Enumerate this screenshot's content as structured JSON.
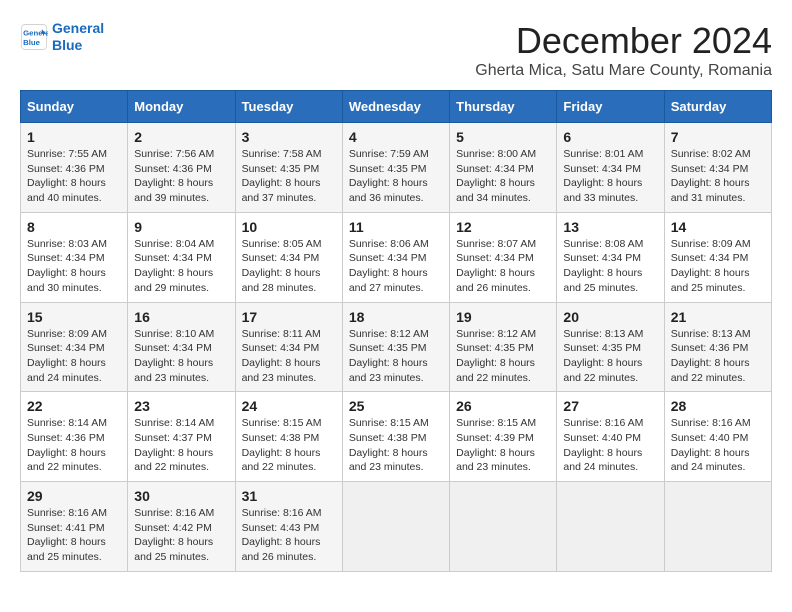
{
  "header": {
    "logo_line1": "General",
    "logo_line2": "Blue",
    "month": "December 2024",
    "location": "Gherta Mica, Satu Mare County, Romania"
  },
  "weekdays": [
    "Sunday",
    "Monday",
    "Tuesday",
    "Wednesday",
    "Thursday",
    "Friday",
    "Saturday"
  ],
  "weeks": [
    [
      {
        "day": "1",
        "info": "Sunrise: 7:55 AM\nSunset: 4:36 PM\nDaylight: 8 hours\nand 40 minutes."
      },
      {
        "day": "2",
        "info": "Sunrise: 7:56 AM\nSunset: 4:36 PM\nDaylight: 8 hours\nand 39 minutes."
      },
      {
        "day": "3",
        "info": "Sunrise: 7:58 AM\nSunset: 4:35 PM\nDaylight: 8 hours\nand 37 minutes."
      },
      {
        "day": "4",
        "info": "Sunrise: 7:59 AM\nSunset: 4:35 PM\nDaylight: 8 hours\nand 36 minutes."
      },
      {
        "day": "5",
        "info": "Sunrise: 8:00 AM\nSunset: 4:34 PM\nDaylight: 8 hours\nand 34 minutes."
      },
      {
        "day": "6",
        "info": "Sunrise: 8:01 AM\nSunset: 4:34 PM\nDaylight: 8 hours\nand 33 minutes."
      },
      {
        "day": "7",
        "info": "Sunrise: 8:02 AM\nSunset: 4:34 PM\nDaylight: 8 hours\nand 31 minutes."
      }
    ],
    [
      {
        "day": "8",
        "info": "Sunrise: 8:03 AM\nSunset: 4:34 PM\nDaylight: 8 hours\nand 30 minutes."
      },
      {
        "day": "9",
        "info": "Sunrise: 8:04 AM\nSunset: 4:34 PM\nDaylight: 8 hours\nand 29 minutes."
      },
      {
        "day": "10",
        "info": "Sunrise: 8:05 AM\nSunset: 4:34 PM\nDaylight: 8 hours\nand 28 minutes."
      },
      {
        "day": "11",
        "info": "Sunrise: 8:06 AM\nSunset: 4:34 PM\nDaylight: 8 hours\nand 27 minutes."
      },
      {
        "day": "12",
        "info": "Sunrise: 8:07 AM\nSunset: 4:34 PM\nDaylight: 8 hours\nand 26 minutes."
      },
      {
        "day": "13",
        "info": "Sunrise: 8:08 AM\nSunset: 4:34 PM\nDaylight: 8 hours\nand 25 minutes."
      },
      {
        "day": "14",
        "info": "Sunrise: 8:09 AM\nSunset: 4:34 PM\nDaylight: 8 hours\nand 25 minutes."
      }
    ],
    [
      {
        "day": "15",
        "info": "Sunrise: 8:09 AM\nSunset: 4:34 PM\nDaylight: 8 hours\nand 24 minutes."
      },
      {
        "day": "16",
        "info": "Sunrise: 8:10 AM\nSunset: 4:34 PM\nDaylight: 8 hours\nand 23 minutes."
      },
      {
        "day": "17",
        "info": "Sunrise: 8:11 AM\nSunset: 4:34 PM\nDaylight: 8 hours\nand 23 minutes."
      },
      {
        "day": "18",
        "info": "Sunrise: 8:12 AM\nSunset: 4:35 PM\nDaylight: 8 hours\nand 23 minutes."
      },
      {
        "day": "19",
        "info": "Sunrise: 8:12 AM\nSunset: 4:35 PM\nDaylight: 8 hours\nand 22 minutes."
      },
      {
        "day": "20",
        "info": "Sunrise: 8:13 AM\nSunset: 4:35 PM\nDaylight: 8 hours\nand 22 minutes."
      },
      {
        "day": "21",
        "info": "Sunrise: 8:13 AM\nSunset: 4:36 PM\nDaylight: 8 hours\nand 22 minutes."
      }
    ],
    [
      {
        "day": "22",
        "info": "Sunrise: 8:14 AM\nSunset: 4:36 PM\nDaylight: 8 hours\nand 22 minutes."
      },
      {
        "day": "23",
        "info": "Sunrise: 8:14 AM\nSunset: 4:37 PM\nDaylight: 8 hours\nand 22 minutes."
      },
      {
        "day": "24",
        "info": "Sunrise: 8:15 AM\nSunset: 4:38 PM\nDaylight: 8 hours\nand 22 minutes."
      },
      {
        "day": "25",
        "info": "Sunrise: 8:15 AM\nSunset: 4:38 PM\nDaylight: 8 hours\nand 23 minutes."
      },
      {
        "day": "26",
        "info": "Sunrise: 8:15 AM\nSunset: 4:39 PM\nDaylight: 8 hours\nand 23 minutes."
      },
      {
        "day": "27",
        "info": "Sunrise: 8:16 AM\nSunset: 4:40 PM\nDaylight: 8 hours\nand 24 minutes."
      },
      {
        "day": "28",
        "info": "Sunrise: 8:16 AM\nSunset: 4:40 PM\nDaylight: 8 hours\nand 24 minutes."
      }
    ],
    [
      {
        "day": "29",
        "info": "Sunrise: 8:16 AM\nSunset: 4:41 PM\nDaylight: 8 hours\nand 25 minutes."
      },
      {
        "day": "30",
        "info": "Sunrise: 8:16 AM\nSunset: 4:42 PM\nDaylight: 8 hours\nand 25 minutes."
      },
      {
        "day": "31",
        "info": "Sunrise: 8:16 AM\nSunset: 4:43 PM\nDaylight: 8 hours\nand 26 minutes."
      },
      {
        "day": "",
        "info": ""
      },
      {
        "day": "",
        "info": ""
      },
      {
        "day": "",
        "info": ""
      },
      {
        "day": "",
        "info": ""
      }
    ]
  ]
}
